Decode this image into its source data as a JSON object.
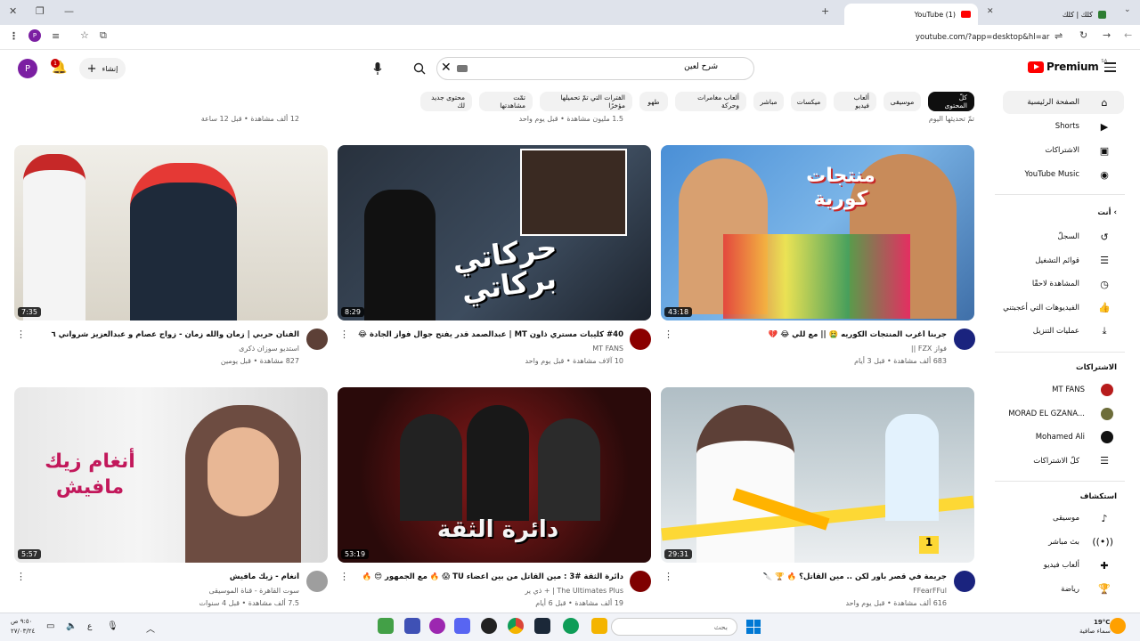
{
  "browser": {
    "tab_active_title": "(1) YouTube",
    "tab_other_title": "كلك | كلك",
    "address": "youtube.com/?app=desktop&hl=ar"
  },
  "header": {
    "logo_text": "Premium",
    "region": "SA",
    "search_value": "شرح لعين",
    "create_label": "إنشاء",
    "avatar_letter": "P",
    "notif_count": "1"
  },
  "chips": [
    "كلّ المحتوى",
    "موسيقى",
    "ألعاب فيديو",
    "ميكسات",
    "مباشر",
    "ألعاب مغامرات وحركة",
    "طهو",
    "الفترات التي تمّ تحميلها مؤخرًا",
    "تمّت مشاهدتها",
    "محتوى جديد لك"
  ],
  "sidebar": {
    "main": [
      {
        "label": "الصفحة الرئيسية",
        "icon": "home-icon"
      },
      {
        "label": "Shorts",
        "icon": "shorts-icon"
      },
      {
        "label": "الاشتراكات",
        "icon": "subscriptions-icon"
      },
      {
        "label": "YouTube Music",
        "icon": "music-icon"
      }
    ],
    "you_head": "أنت",
    "you": [
      {
        "label": "السجلّ",
        "icon": "history-icon"
      },
      {
        "label": "قوائم التشغيل",
        "icon": "playlist-icon"
      },
      {
        "label": "المشاهدة لاحقًا",
        "icon": "clock-icon"
      },
      {
        "label": "الفيديوهات التي أعجبتني",
        "icon": "like-icon"
      },
      {
        "label": "عمليات التنزيل",
        "icon": "download-icon"
      }
    ],
    "subs_head": "الاشتراكات",
    "subs": [
      {
        "label": "MT FANS",
        "color": "#b71c1c"
      },
      {
        "label": "MORAD EL GZANA...",
        "color": "#6d6d3a"
      },
      {
        "label": "Mohamed Ali",
        "color": "#111111"
      },
      {
        "label": "كلّ الاشتراكات",
        "color": ""
      }
    ],
    "explore_head": "استكشاف",
    "explore": [
      {
        "label": "موسيقى",
        "icon": "music-note-icon"
      },
      {
        "label": "بث مباشر",
        "icon": "live-icon"
      },
      {
        "label": "ألعاب فيديو",
        "icon": "gamepad-icon"
      },
      {
        "label": "رياضة",
        "icon": "trophy-icon"
      }
    ]
  },
  "prev_row": [
    {
      "meta": "12 ألف مشاهدة • قبل 12 ساعة"
    },
    {
      "meta": "1.5 مليون مشاهدة • قبل يوم واحد"
    },
    {
      "meta": "تمّ تحديثها اليوم"
    }
  ],
  "videos": [
    {
      "title": "جربنا أغرب المنتجات الكوريه 🤮 || مع للي 😂 💔",
      "channel": "فواز FZX ||",
      "meta": "683 ألف مشاهدة • قبل 3 أيام",
      "duration": "43:18",
      "thumb_text": "منتجات كورية",
      "avatar_color": "#1a237e"
    },
    {
      "title": "#40 كليبات مستري ذاون MT | عبدالصمد قدر يفتح جوال فواز الجادة 😂 !!",
      "channel": "MT FANS",
      "meta": "10 آلاف مشاهدة • قبل يوم واحد",
      "duration": "8:29",
      "thumb_text": "حركاتي بركاتي",
      "avatar_color": "#8b0000"
    },
    {
      "title": "الفنان حربي | زمان والله زمان - زواج عصام و عبدالعزيز شرواني ٦",
      "channel": "استديو سوزان ذكرى",
      "meta": "827 مشاهدة • قبل يومين",
      "duration": "7:35",
      "thumb_text": "",
      "avatar_color": "#5d4037"
    },
    {
      "title": "جريمة في قصر باور لكن .. مين القاتل؟ 🔥 🏆 🔪",
      "channel": "FFearFFul",
      "meta": "616 ألف مشاهدة • قبل يوم واحد",
      "duration": "29:31",
      "thumb_text": "",
      "avatar_color": "#1a237e"
    },
    {
      "title": "دائرة الثقة #3 : مين القاتل من بين أعضاء TU 😱 🔥 مع الجمهور 😍 🔥",
      "channel": "The Ultimates Plus | + ذي ير",
      "meta": "19 ألف مشاهدة • قبل 6 أيام",
      "duration": "53:19",
      "thumb_text": "دائرة الثقة",
      "avatar_color": "#7f0000"
    },
    {
      "title": "أنغام - زيك مافيش",
      "channel": "سوت القاهرة - قناة الموسيقى",
      "meta": "7.5 ألف مشاهدة • قبل 4 سنوات",
      "duration": "5:57",
      "thumb_text": "أنغام زيك مافيش",
      "avatar_color": "#9e9e9e"
    }
  ],
  "taskbar": {
    "search_placeholder": "بحث",
    "weather_temp": "19°C",
    "weather_desc": "سماء صافية",
    "time": "٩:٥٠ ص",
    "date": "٢٧/٠٣/٢٤",
    "lang": "ع"
  }
}
